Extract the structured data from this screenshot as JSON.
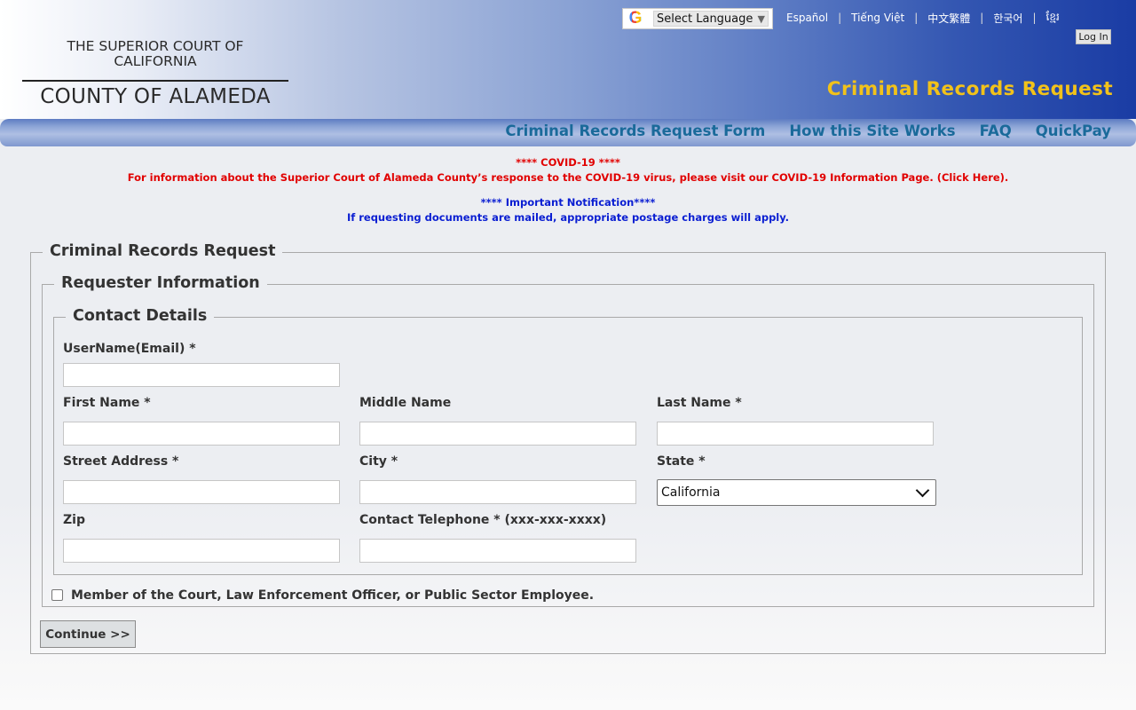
{
  "header": {
    "court_line1": "THE SUPERIOR COURT OF",
    "court_line2": "CALIFORNIA",
    "county": "COUNTY OF ALAMEDA",
    "site_title": "Criminal Records Request",
    "translate": {
      "icon": "google-g-icon",
      "label": "Select Language",
      "arrow": "▼"
    },
    "languages": [
      "Español",
      "Tiếng Việt",
      "中文繁體",
      "한국어",
      "ខ្មែរ"
    ],
    "login_label": "Log In"
  },
  "nav": {
    "items": [
      "Criminal Records Request Form",
      "How this Site Works",
      "FAQ",
      "QuickPay"
    ]
  },
  "notices": {
    "covid_title": "**** COVID-19 ****",
    "covid_text": "For information about the Superior Court of Alameda County’s response to the COVID-19 virus, please visit our  COVID-19 Information Page. (Click Here).",
    "important_title": "**** Important Notification****",
    "important_text": "If requesting documents are mailed, appropriate postage charges will apply."
  },
  "form": {
    "outer_legend": "Criminal Records Request",
    "requester_legend": "Requester Information",
    "contact_legend": "Contact Details",
    "labels": {
      "username": "UserName(Email) *",
      "first_name": "First Name *",
      "middle_name": "Middle Name",
      "last_name": "Last Name *",
      "street": "Street Address *",
      "city": "City *",
      "state": "State *",
      "zip": "Zip",
      "phone": "Contact Telephone * (xxx-xxx-xxxx)"
    },
    "values": {
      "username": "",
      "first_name": "",
      "middle_name": "",
      "last_name": "",
      "street": "",
      "city": "",
      "state": "California",
      "zip": "",
      "phone": ""
    },
    "member_checkbox_label": "Member of the Court, Law Enforcement Officer, or Public Sector Employee.",
    "member_checked": false,
    "continue_label": "Continue >>"
  },
  "colors": {
    "title_gold": "#f2c21a",
    "nav_link": "#1a6a9a",
    "notice_red": "#e10000",
    "notice_blue": "#0a1ed2"
  }
}
